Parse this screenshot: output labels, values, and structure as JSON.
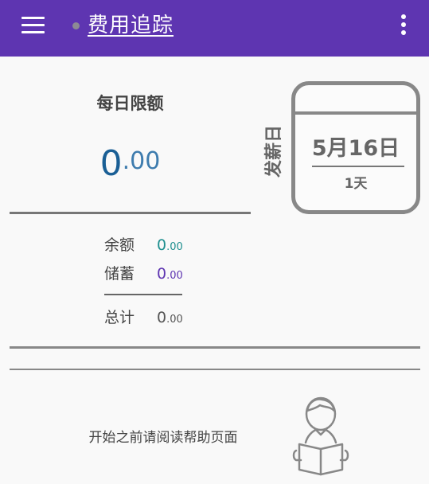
{
  "app_bar": {
    "title": "费用追踪",
    "menu_icon": "hamburger-menu-icon",
    "more_icon": "more-vertical-icon",
    "background_color": "#5e35b1"
  },
  "daily_limit": {
    "label": "每日限额",
    "value_int": "0",
    "value_dec": ".00"
  },
  "payday": {
    "label": "发薪日",
    "date": "5月16日",
    "days_left": "1天"
  },
  "stats": {
    "balance_label": "余额",
    "balance_int": "0",
    "balance_dec": ".00",
    "savings_label": "储蓄",
    "savings_int": "0",
    "savings_dec": ".00",
    "total_label": "总计",
    "total_int": "0",
    "total_dec": ".00"
  },
  "help": {
    "text": "开始之前请阅读帮助页面",
    "icon": "person-reading-book-icon"
  },
  "colors": {
    "balance": "#1e8f8f",
    "savings": "#5e35b1",
    "limit": "#1a5f95"
  }
}
